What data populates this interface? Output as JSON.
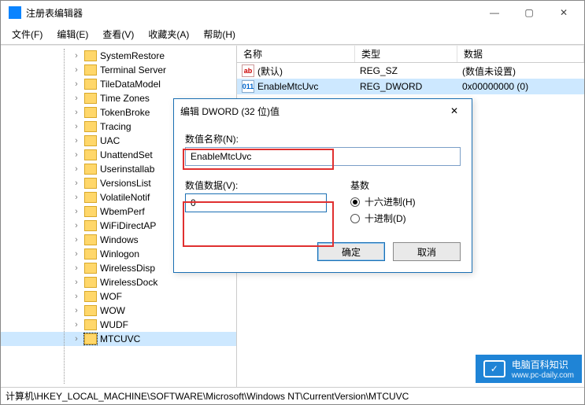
{
  "window": {
    "title": "注册表编辑器",
    "min": "—",
    "max": "▢",
    "close": "✕"
  },
  "menu": {
    "file": "文件(F)",
    "edit": "编辑(E)",
    "view": "查看(V)",
    "fav": "收藏夹(A)",
    "help": "帮助(H)"
  },
  "tree": [
    "SystemRestore",
    "Terminal Server",
    "TileDataModel",
    "Time Zones",
    "TokenBroke",
    "Tracing",
    "UAC",
    "UnattendSet",
    "Userinstallab",
    "VersionsList",
    "VolatileNotif",
    "WbemPerf",
    "WiFiDirectAP",
    "Windows",
    "Winlogon",
    "WirelessDisp",
    "WirelessDock",
    "WOF",
    "WOW",
    "WUDF",
    "MTCUVC"
  ],
  "tree_selected_index": 20,
  "columns": {
    "name": "名称",
    "type": "类型",
    "data": "数据"
  },
  "rows": [
    {
      "icon": "str",
      "name": "(默认)",
      "type": "REG_SZ",
      "data": "(数值未设置)"
    },
    {
      "icon": "bin",
      "name": "EnableMtcUvc",
      "type": "REG_DWORD",
      "data": "0x00000000 (0)"
    }
  ],
  "row_selected_index": 1,
  "dialog": {
    "title": "编辑 DWORD (32 位)值",
    "name_label": "数值名称(N):",
    "name_value": "EnableMtcUvc",
    "data_label": "数值数据(V):",
    "data_value": "0",
    "base_label": "基数",
    "radio_hex": "十六进制(H)",
    "radio_dec": "十进制(D)",
    "ok": "确定",
    "cancel": "取消",
    "close": "✕"
  },
  "status": "计算机\\HKEY_LOCAL_MACHINE\\SOFTWARE\\Microsoft\\Windows NT\\CurrentVersion\\MTCUVC",
  "watermark": {
    "title": "电脑百科知识",
    "sub": "www.pc-daily.com"
  },
  "icon_text": {
    "str": "ab",
    "bin": "011"
  }
}
